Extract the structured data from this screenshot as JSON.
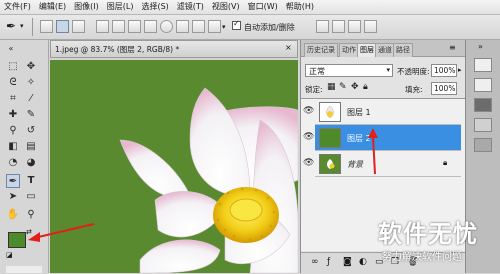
{
  "menu": [
    "文件(F)",
    "编辑(E)",
    "图像(I)",
    "图层(L)",
    "选择(S)",
    "滤镜(T)",
    "视图(V)",
    "窗口(W)",
    "帮助(H)"
  ],
  "options": {
    "auto_add_delete_label": "自动添加/删除"
  },
  "document": {
    "tab_title": "1.jpeg @ 83.7% (图层 2, RGB/8) *"
  },
  "panel_tabs": [
    "历史记录",
    "动作",
    "图层",
    "通道",
    "路径"
  ],
  "layers_panel": {
    "blend_mode": "正常",
    "opacity_label": "不透明度:",
    "opacity_value": "100%",
    "lock_label": "锁定:",
    "fill_label": "填充:",
    "fill_value": "100%",
    "layers": [
      {
        "name": "图层 1",
        "selected": false
      },
      {
        "name": "图层 2",
        "selected": true
      },
      {
        "name": "背景",
        "selected": false,
        "locked": true
      }
    ]
  },
  "foreground_color": "#4f8a2a",
  "canvas_color": "#598a2f",
  "selection_color": "#2f8fe0",
  "watermark": {
    "title": "软件无忧",
    "subtitle": "努力解决软件问题"
  }
}
